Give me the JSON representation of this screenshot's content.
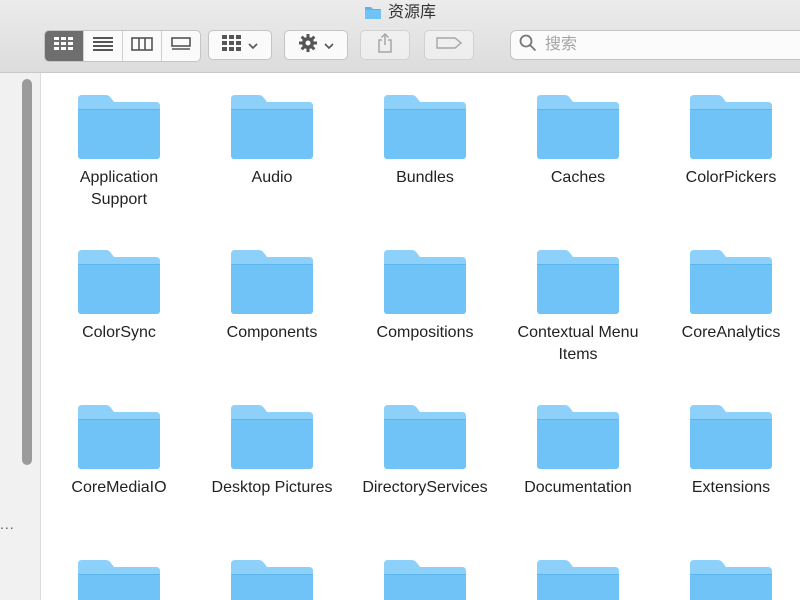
{
  "window": {
    "title": "资源库",
    "icon": "folder-icon"
  },
  "toolbar": {
    "views": [
      {
        "name": "icon-view",
        "icon": "grid-icon",
        "active": true
      },
      {
        "name": "list-view",
        "icon": "list-icon",
        "active": false
      },
      {
        "name": "column-view",
        "icon": "columns-icon",
        "active": false
      },
      {
        "name": "gallery-view",
        "icon": "gallery-icon",
        "active": false
      }
    ],
    "group_button": {
      "icon": "group-icon"
    },
    "action_button": {
      "icon": "gear-icon"
    },
    "share_button": {
      "icon": "share-icon"
    },
    "tag_button": {
      "icon": "tag-icon"
    },
    "search": {
      "placeholder": "搜索",
      "value": ""
    }
  },
  "folders": [
    [
      "Application",
      "Support"
    ],
    [
      "Audio"
    ],
    [
      "Bundles"
    ],
    [
      "Caches"
    ],
    [
      "ColorPickers"
    ],
    [
      "ColorSync"
    ],
    [
      "Components"
    ],
    [
      "Compositions"
    ],
    [
      "Contextual Menu",
      "Items"
    ],
    [
      "CoreAnalytics"
    ],
    [
      "CoreMediaIO"
    ],
    [
      "Desktop Pictures"
    ],
    [
      "DirectoryServices"
    ],
    [
      "Documentation"
    ],
    [
      "Extensions"
    ],
    [],
    [],
    [],
    [],
    []
  ],
  "colors": {
    "folder_body": "#6fc3f7",
    "folder_tab": "#8dd0f9",
    "folder_edge": "#5bb4ec"
  },
  "sidebar": {
    "dots": "..."
  }
}
